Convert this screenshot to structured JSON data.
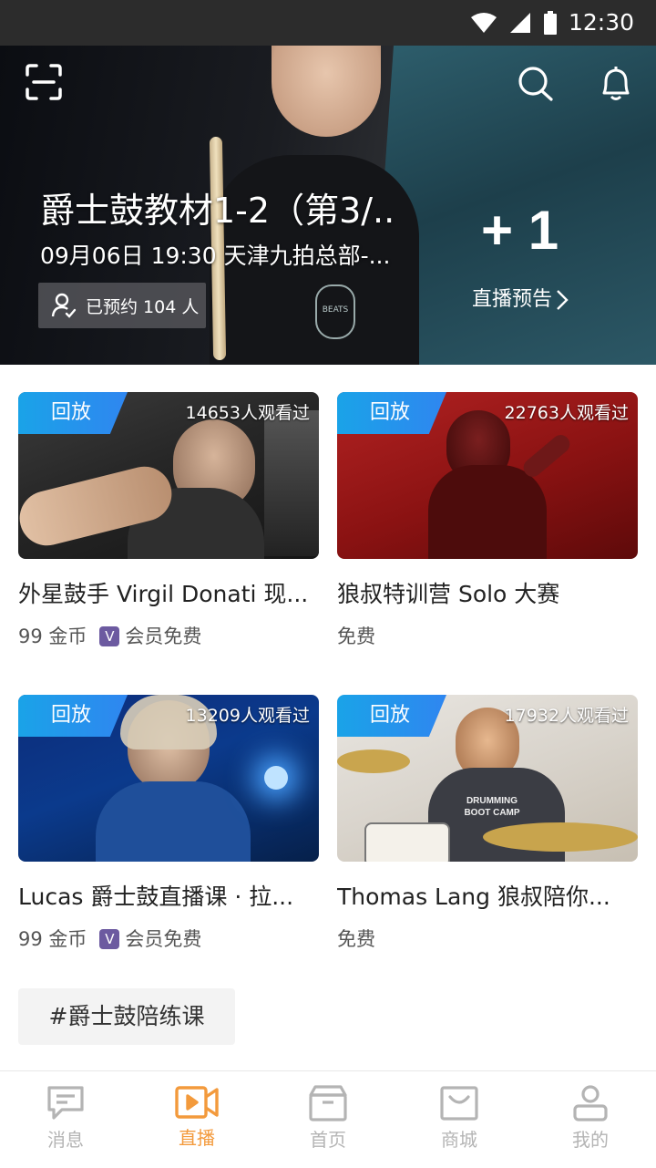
{
  "status_bar": {
    "time": "12:30"
  },
  "hero": {
    "title": "爵士鼓教材1-2（第3/..",
    "datetime": "09月06日  19:30 天津九拍总部-...",
    "reserve_text": "已预约 104 人",
    "plus": "+ 1",
    "preview_label": "直播预告",
    "shirt_logo": "BEATS"
  },
  "cards": [
    {
      "badge": "回放",
      "views": "14653人观看过",
      "title": "外星鼓手 Virgil Donati 现...",
      "price": "99 金币",
      "vip_label": "会员免费",
      "vip_mark": "V"
    },
    {
      "badge": "回放",
      "views": "22763人观看过",
      "title": "狼叔特训营 Solo 大赛",
      "price": "免费"
    },
    {
      "badge": "回放",
      "views": "13209人观看过",
      "title": "Lucas 爵士鼓直播课 · 拉...",
      "price": "99 金币",
      "vip_label": "会员免费",
      "vip_mark": "V"
    },
    {
      "badge": "回放",
      "views": "17932人观看过",
      "title": "Thomas Lang 狼叔陪你...",
      "price": "免费",
      "shirt_text": "DRUMMING BOOT CAMP"
    }
  ],
  "tag": "#爵士鼓陪练课",
  "nav": [
    {
      "label": "消息",
      "icon": "message-icon",
      "active": false
    },
    {
      "label": "直播",
      "icon": "live-camera-icon",
      "active": true
    },
    {
      "label": "首页",
      "icon": "home-box-icon",
      "active": false
    },
    {
      "label": "商城",
      "icon": "shop-bag-icon",
      "active": false
    },
    {
      "label": "我的",
      "icon": "profile-icon",
      "active": false
    }
  ],
  "colors": {
    "accent": "#f39a3c",
    "badge_blue": "#1aa3e8",
    "nav_inactive": "#b4b4b4",
    "vip_purple": "#6c5aa0"
  }
}
